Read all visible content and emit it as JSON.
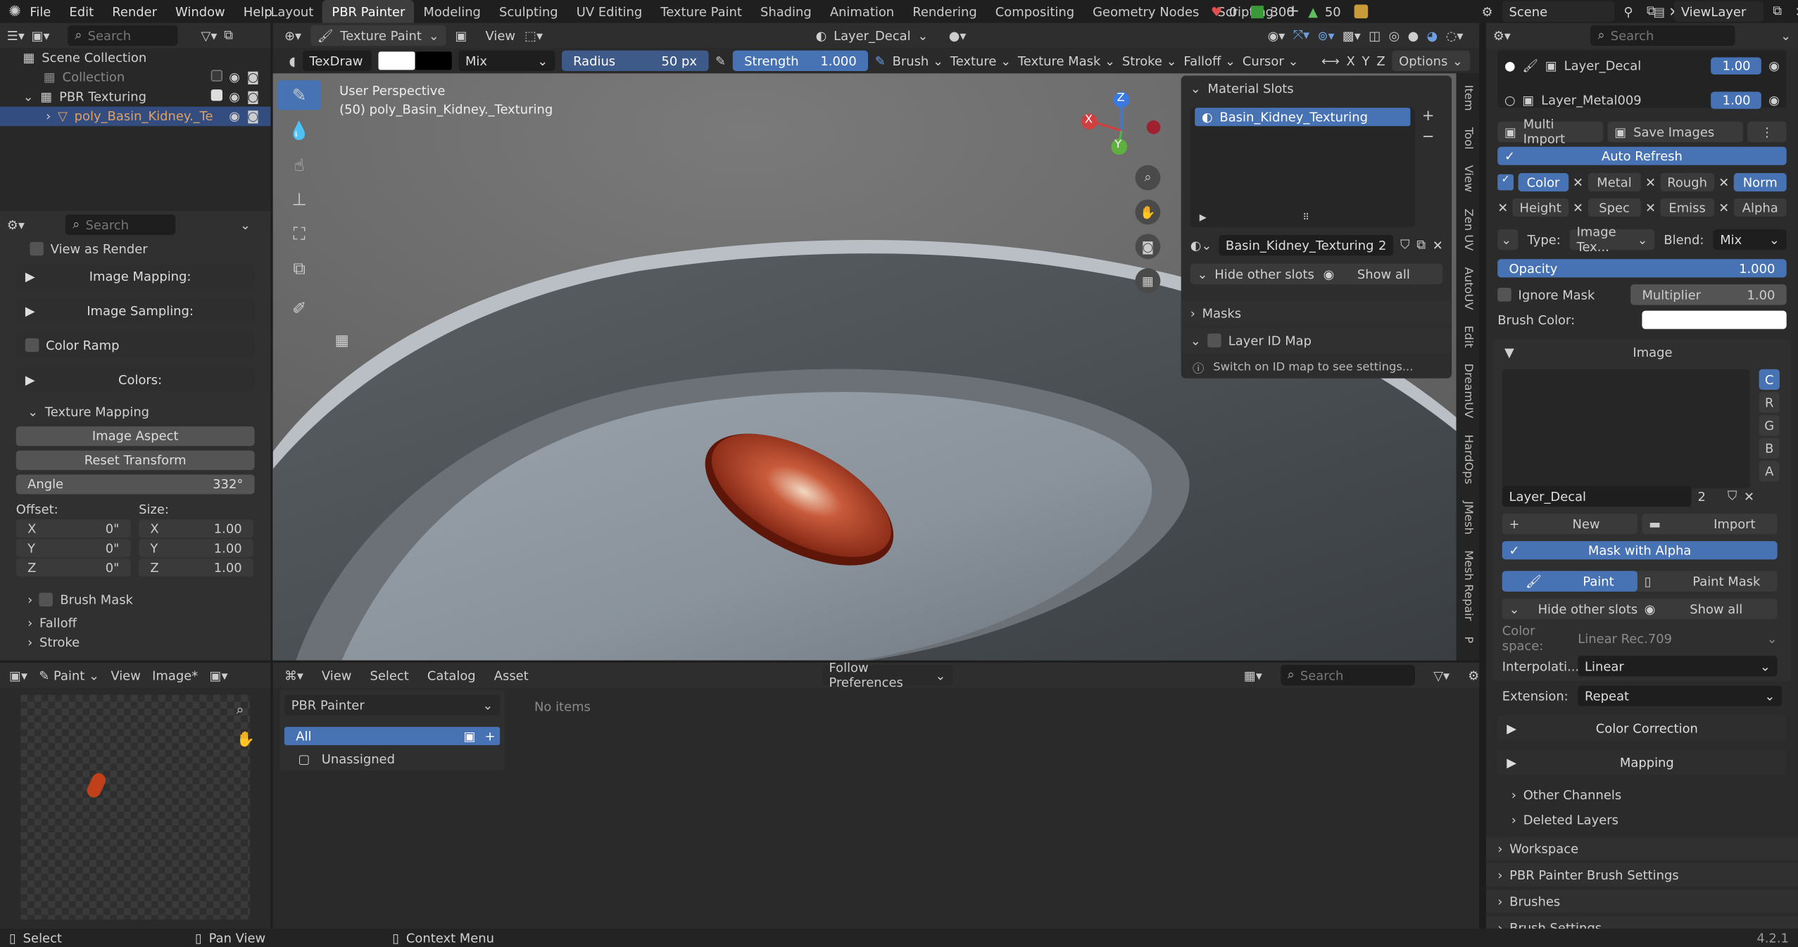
{
  "topbar": {
    "menus": [
      "File",
      "Edit",
      "Render",
      "Window",
      "Help"
    ],
    "workspaces": [
      "Layout",
      "PBR Painter",
      "Modeling",
      "Sculpting",
      "UV Editing",
      "Texture Paint",
      "Shading",
      "Animation",
      "Rendering",
      "Compositing",
      "Geometry Nodes",
      "Scripting"
    ],
    "active_workspace": "PBR Painter",
    "scene": "Scene",
    "view_layer": "ViewLayer",
    "stat_a": "0",
    "stat_b": "300",
    "stat_c": "50"
  },
  "outliner": {
    "search_placeholder": "Search",
    "scene_collection": "Scene Collection",
    "collection": "Collection",
    "pbr_collection": "PBR Texturing",
    "object": "poly_Basin_Kidney._Te"
  },
  "props_left": {
    "search_placeholder": "Search",
    "view_as_render": "View as Render",
    "image_mapping": "Image Mapping:",
    "image_sampling": "Image Sampling:",
    "color_ramp": "Color Ramp",
    "colors": "Colors:",
    "texture_mapping": "Texture Mapping",
    "image_aspect": "Image Aspect",
    "reset_transform": "Reset Transform",
    "angle_label": "Angle",
    "angle_value": "332°",
    "offset_label": "Offset:",
    "size_label": "Size:",
    "offset": [
      {
        "axis": "X",
        "value": "0\""
      },
      {
        "axis": "Y",
        "value": "0\""
      },
      {
        "axis": "Z",
        "value": "0\""
      }
    ],
    "size": [
      {
        "axis": "X",
        "value": "1.00"
      },
      {
        "axis": "Y",
        "value": "1.00"
      },
      {
        "axis": "Z",
        "value": "1.00"
      }
    ],
    "brush_mask": "Brush Mask",
    "falloff": "Falloff",
    "stroke": "Stroke"
  },
  "viewport_header": {
    "mode": "Texture Paint",
    "view": "View",
    "layer": "Layer_Decal"
  },
  "tool_header": {
    "brush_name": "TexDraw",
    "blend": "Mix",
    "radius_label": "Radius",
    "radius_value": "50 px",
    "strength_label": "Strength",
    "strength_value": "1.000",
    "brush": "Brush",
    "texture": "Texture",
    "texture_mask": "Texture Mask",
    "stroke": "Stroke",
    "falloff": "Falloff",
    "cursor": "Cursor",
    "x": "X",
    "y": "Y",
    "z": "Z",
    "options": "Options"
  },
  "viewport": {
    "line1": "User Perspective",
    "line2": "(50) poly_Basin_Kidney._Texturing",
    "gizmo_x": "X",
    "gizmo_y": "Y",
    "gizmo_z": "Z"
  },
  "material_panel": {
    "title": "Material Slots",
    "slot": "Basin_Kidney_Texturing",
    "material_name": "Basin_Kidney_Texturing",
    "users": "2",
    "hide_other": "Hide other slots",
    "show_all": "Show all",
    "masks": "Masks",
    "layer_id_map": "Layer ID Map",
    "id_map_info": "Switch on ID map to see settings..."
  },
  "side_tabs": [
    "Item",
    "Tool",
    "View",
    "Zen UV",
    "AutoUV",
    "Edit",
    "DreamUV",
    "HardOps",
    "JMesh",
    "Mesh Repair",
    "P"
  ],
  "right_panel": {
    "layers": [
      {
        "name": "Layer_Decal",
        "value": "1.00"
      },
      {
        "name": "Layer_Metal009",
        "value": "1.00"
      }
    ],
    "multi_import": "Multi Import",
    "save_images": "Save Images",
    "auto_refresh": "Auto Refresh",
    "channels": [
      "Color",
      "Metal",
      "Rough",
      "Norm",
      "Height",
      "Spec",
      "Emiss",
      "Alpha"
    ],
    "type_label": "Type:",
    "type_value": "Image Tex...",
    "blend_label": "Blend:",
    "blend_value": "Mix",
    "opacity_label": "Opacity",
    "opacity_value": "1.000",
    "ignore_mask": "Ignore Mask",
    "multiplier_label": "Multiplier",
    "multiplier_value": "1.00",
    "brush_color": "Brush Color:",
    "image_title": "Image",
    "rgba": [
      "C",
      "R",
      "G",
      "B",
      "A"
    ],
    "image_name": "Layer_Decal",
    "image_users": "2",
    "new": "New",
    "import": "Import",
    "mask_with_alpha": "Mask with Alpha",
    "paint": "Paint",
    "paint_mask": "Paint Mask",
    "hide_other": "Hide other slots",
    "show_all": "Show all",
    "color_space_label": "Color space:",
    "color_space_value": "Linear Rec.709",
    "interp_label": "Interpolati...",
    "interp_value": "Linear",
    "extension_label": "Extension:",
    "extension_value": "Repeat",
    "color_correction": "Color Correction",
    "mapping": "Mapping",
    "other_channels": "Other Channels",
    "deleted_layers": "Deleted Layers",
    "workspace": "Workspace",
    "brush_settings_pbr": "PBR Painter Brush Settings",
    "brushes": "Brushes",
    "brush_settings": "Brush Settings"
  },
  "image_editor": {
    "mode": "Paint",
    "view": "View",
    "image": "Image*"
  },
  "asset_browser": {
    "view": "View",
    "select": "Select",
    "catalog": "Catalog",
    "asset": "Asset",
    "library": "Follow Preferences",
    "search_placeholder": "Search",
    "source": "PBR Painter",
    "all": "All",
    "unassigned": "Unassigned",
    "empty": "No items"
  },
  "status": {
    "select": "Select",
    "pan": "Pan View",
    "context": "Context Menu",
    "version": "4.2.1"
  }
}
